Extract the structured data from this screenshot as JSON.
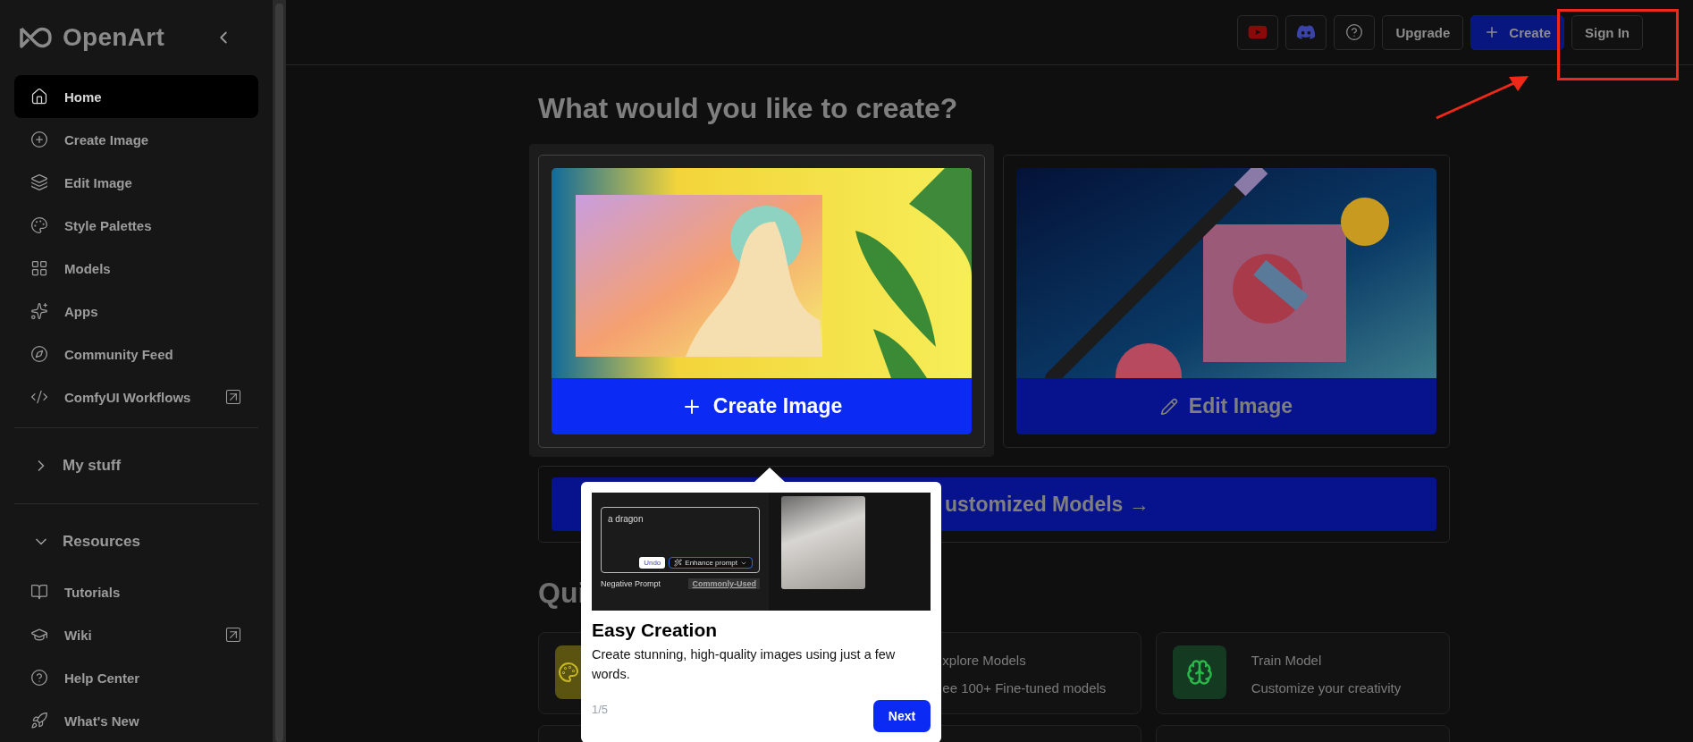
{
  "sidebar": {
    "logo": "OpenArt",
    "nav": [
      {
        "label": "Home",
        "kind": "home",
        "selected": true,
        "external": false
      },
      {
        "label": "Create Image",
        "kind": "plus",
        "selected": false,
        "external": false
      },
      {
        "label": "Edit Image",
        "kind": "layers",
        "selected": false,
        "external": false
      },
      {
        "label": "Style Palettes",
        "kind": "palette",
        "selected": false,
        "external": false
      },
      {
        "label": "Models",
        "kind": "grid",
        "selected": false,
        "external": false
      },
      {
        "label": "Apps",
        "kind": "sparkles",
        "selected": false,
        "external": false
      },
      {
        "label": "Community Feed",
        "kind": "compass",
        "selected": false,
        "external": false
      },
      {
        "label": "ComfyUI Workflows",
        "kind": "code",
        "selected": false,
        "external": true
      }
    ],
    "sections": [
      {
        "label": "My stuff",
        "expanded": false
      },
      {
        "label": "Resources",
        "expanded": true,
        "items": [
          {
            "label": "Tutorials",
            "kind": "book",
            "selected": false,
            "external": false
          },
          {
            "label": "Wiki",
            "kind": "cap",
            "selected": false,
            "external": true
          },
          {
            "label": "Help Center",
            "kind": "help",
            "selected": false,
            "external": false
          },
          {
            "label": "What's New",
            "kind": "rocket",
            "selected": false,
            "external": false
          }
        ]
      }
    ]
  },
  "topbar": {
    "buttons": [
      {
        "kind": "youtube"
      },
      {
        "kind": "discord"
      },
      {
        "kind": "help"
      },
      {
        "kind": "text",
        "label": "Upgrade"
      },
      {
        "kind": "primary",
        "label": "Create"
      },
      {
        "kind": "text",
        "label": "Sign In"
      }
    ]
  },
  "main": {
    "heading": "What would you like to create?",
    "create_cards": [
      {
        "kind": "create",
        "label": "Create Image",
        "highlighted": true
      },
      {
        "kind": "edit",
        "label": "Edit Image",
        "highlighted": false
      }
    ],
    "banner": {
      "label": "ustomized Models →"
    },
    "quick_heading": "Qui",
    "quick_cards": [
      {
        "kind": "palette",
        "color": "#5a5410"
      },
      {
        "title": "xplore Models",
        "subtitle": "ee 100+ Fine-tuned models"
      },
      {
        "kind": "brain",
        "title": "Train Model",
        "subtitle": "Customize your creativity",
        "color": "#143a22"
      },
      {
        "kind": "blank"
      },
      {
        "kind": "blank"
      },
      {
        "kind": "blank"
      }
    ]
  },
  "tour": {
    "title": "Easy Creation",
    "text": "Create stunning, high-quality images using just a few words.",
    "step": "1/5",
    "next": "Next",
    "preview": {
      "prompt_value": "a dragon",
      "undo": "Undo",
      "enhance": "Enhance prompt",
      "negative_label": "Negative Prompt",
      "commonly_used": "Commonly-Used"
    }
  }
}
